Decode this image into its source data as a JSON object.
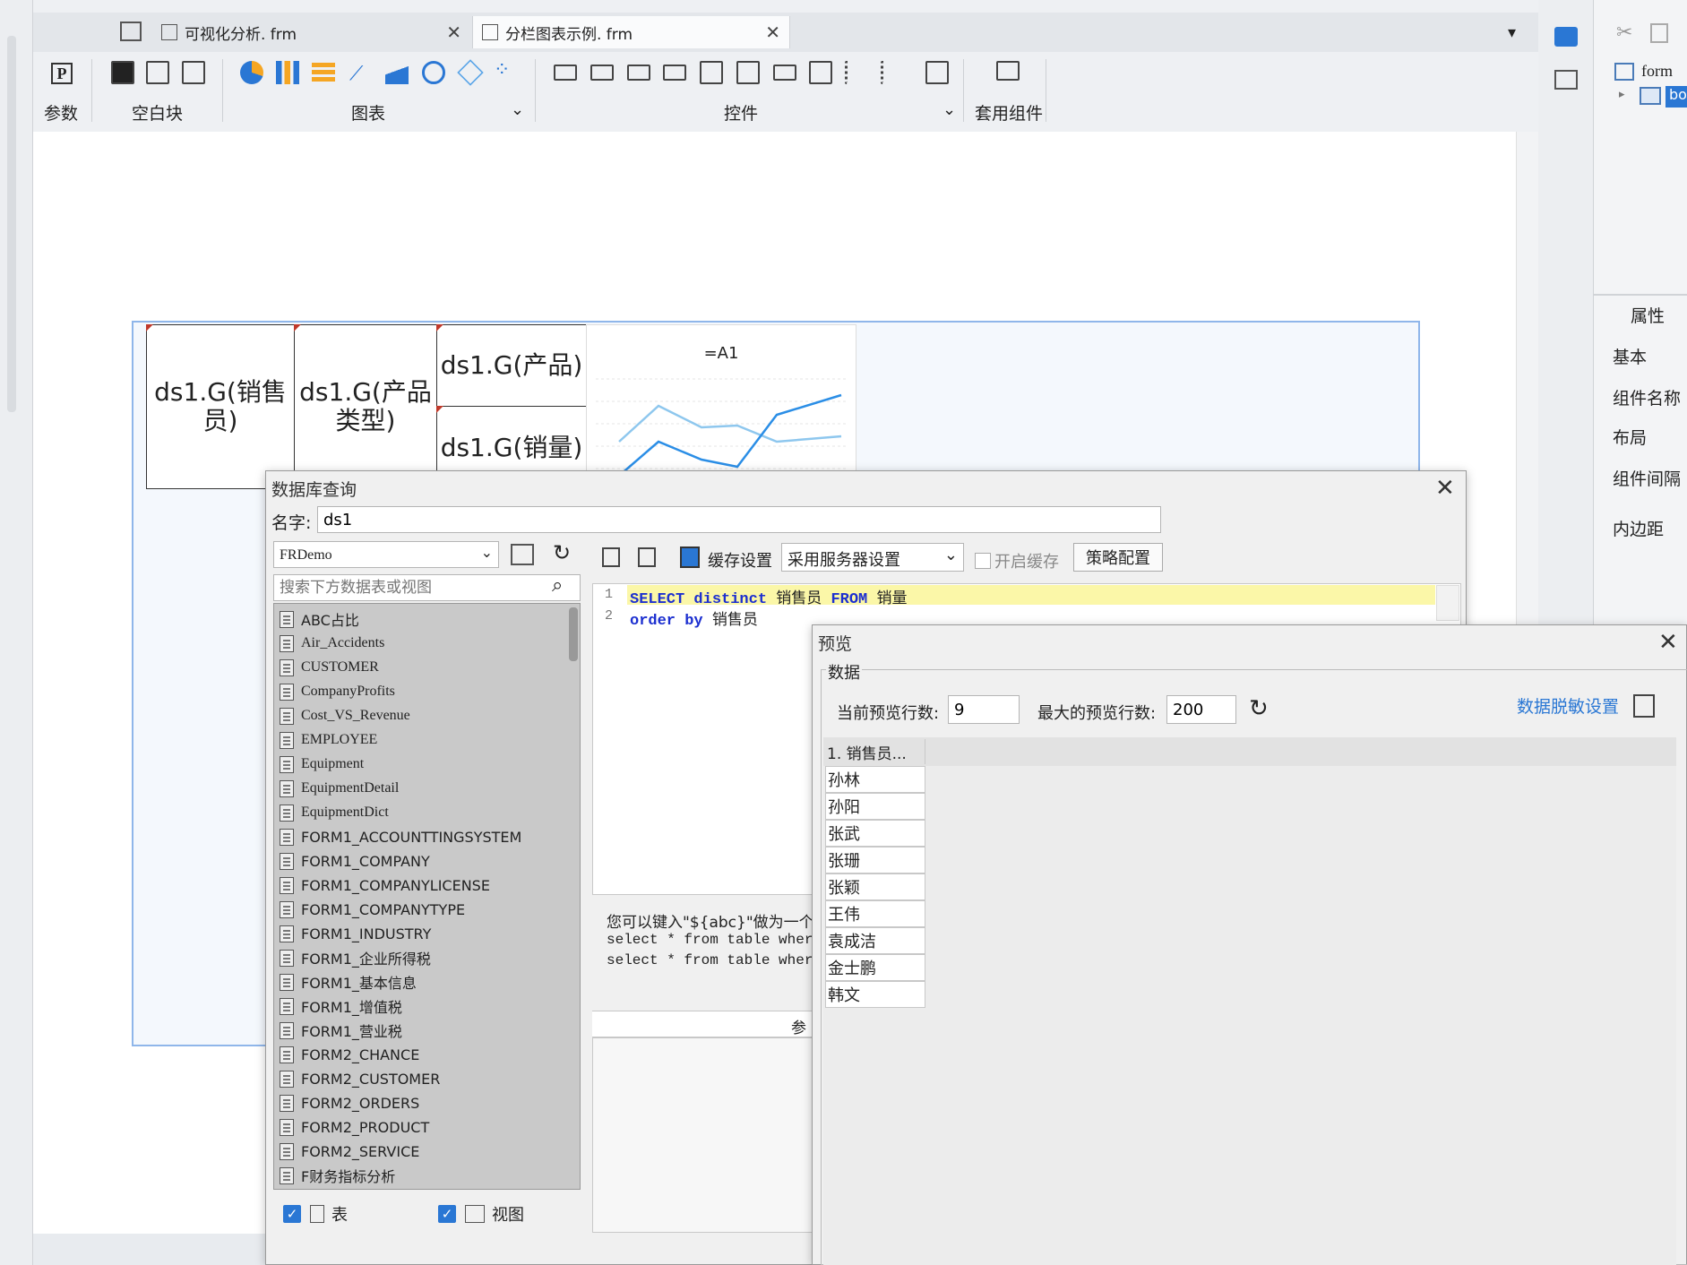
{
  "tabs": [
    {
      "label": "可视化分析. frm"
    },
    {
      "label": "分栏图表示例. frm"
    }
  ],
  "toolbar": {
    "groups": {
      "param": "参数",
      "blank": "空白块",
      "chart": "图表",
      "widget": "控件",
      "suite": "套用组件"
    },
    "param_icon": "P"
  },
  "right_panel": {
    "tree_root": "form",
    "tree_child": "bo",
    "attr_title": "属性",
    "items": [
      "基本",
      "组件名称",
      "布局",
      "组件间隔",
      "内边距"
    ]
  },
  "design": {
    "cells": {
      "salesman": "ds1.G(销售员)",
      "ptype": "ds1.G(产品类型)",
      "product": "ds1.G(产品)",
      "sales": "ds1.G(销量)"
    },
    "chart_title": "=A1"
  },
  "db_dialog": {
    "title": "数据库查询",
    "name_label": "名字:",
    "name_value": "ds1",
    "connection": "FRDemo",
    "search_placeholder": "搜索下方数据表或视图",
    "tables": [
      "ABC占比",
      "Air_Accidents",
      "CUSTOMER",
      "CompanyProfits",
      "Cost_VS_Revenue",
      "EMPLOYEE",
      "Equipment",
      "EquipmentDetail",
      "EquipmentDict",
      "FORM1_ACCOUNTTINGSYSTEM",
      "FORM1_COMPANY",
      "FORM1_COMPANYLICENSE",
      "FORM1_COMPANYTYPE",
      "FORM1_INDUSTRY",
      "FORM1_企业所得税",
      "FORM1_基本信息",
      "FORM1_增值税",
      "FORM1_营业税",
      "FORM2_CHANCE",
      "FORM2_CUSTOMER",
      "FORM2_ORDERS",
      "FORM2_PRODUCT",
      "FORM2_SERVICE",
      "F财务指标分析"
    ],
    "filter_table": "表",
    "filter_view": "视图",
    "cache_label": "缓存设置",
    "server_setting": "采用服务器设置",
    "enable_cache": "开启缓存",
    "strategy": "策略配置",
    "sql_line1_kw1": "SELECT distinct",
    "sql_line1_txt1": "销售员",
    "sql_line1_kw2": "FROM",
    "sql_line1_txt2": "销量",
    "sql_line2_kw": "order by",
    "sql_line2_txt": "销售员",
    "hint1": "您可以键入\"${abc}\"做为一个",
    "hint2": "select * from table where",
    "hint3": "select * from table where",
    "param_label": "参",
    "line_numbers": [
      "1",
      "2"
    ]
  },
  "preview": {
    "title": "预览",
    "group": "数据",
    "current_rows_label": "当前预览行数:",
    "current_rows": "9",
    "max_rows_label": "最大的预览行数:",
    "max_rows": "200",
    "desensitize": "数据脱敏设置",
    "col_header": "1. 销售员...",
    "rows": [
      "孙林",
      "孙阳",
      "张武",
      "张珊",
      "张颖",
      "王伟",
      "袁成洁",
      "金士鹏",
      "韩文"
    ]
  },
  "colors": {
    "accent": "#2a77d4",
    "sql_kw": "#1c2fd0",
    "line_light": "#8ec7ee",
    "line_dark": "#2b8ee6"
  }
}
